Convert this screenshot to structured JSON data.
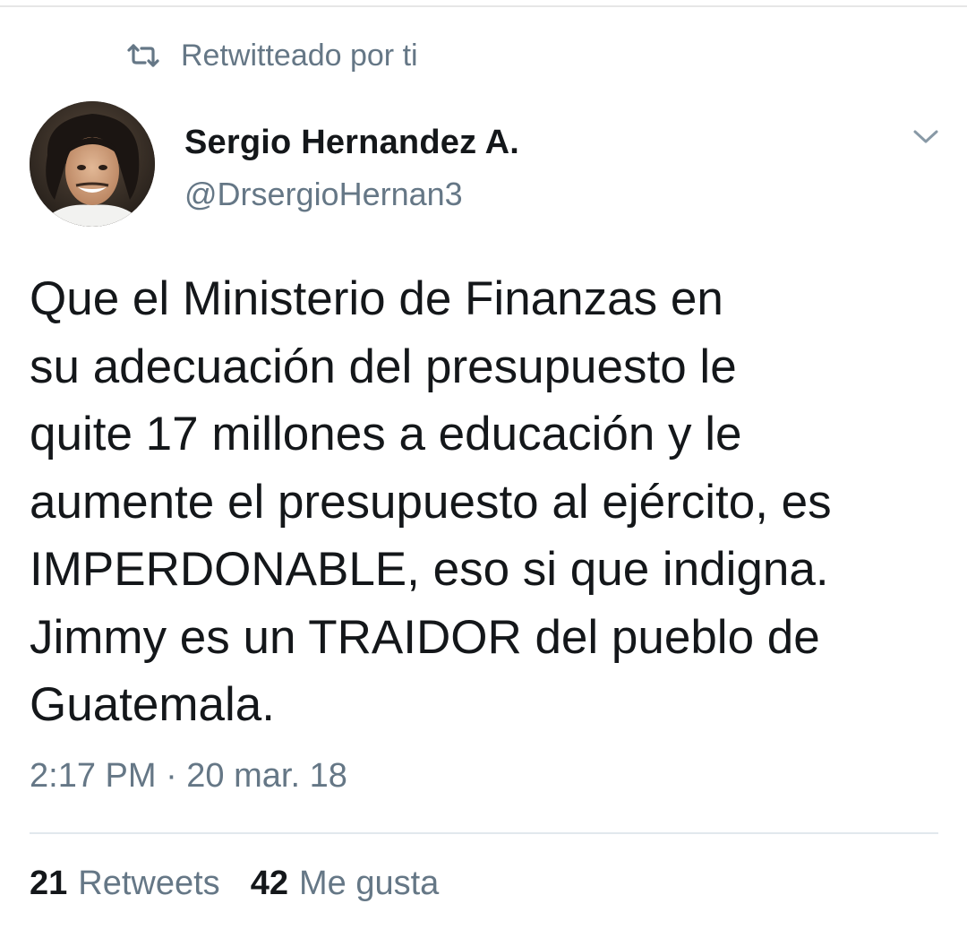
{
  "retweet_context": {
    "icon": "retweet-icon",
    "text": "Retwitteado por ti"
  },
  "author": {
    "name": "Sergio Hernandez A.",
    "handle": "@DrsergioHernan3"
  },
  "tweet": {
    "lines": [
      "Que el Ministerio de Finanzas en",
      "su adecuación del presupuesto le",
      "quite 17 millones a educación y le",
      "aumente el presupuesto al ejército, es",
      "IMPERDONABLE, eso si que indigna.",
      "Jimmy es un TRAIDOR del pueblo de",
      "Guatemala."
    ],
    "timestamp": "2:17 PM · 20 mar. 18"
  },
  "stats": {
    "retweets_count": "21",
    "retweets_label": "Retweets",
    "likes_count": "42",
    "likes_label": "Me gusta"
  },
  "colors": {
    "primary_text": "#14171a",
    "secondary_text": "#657786",
    "divider": "#e1e8ed"
  }
}
